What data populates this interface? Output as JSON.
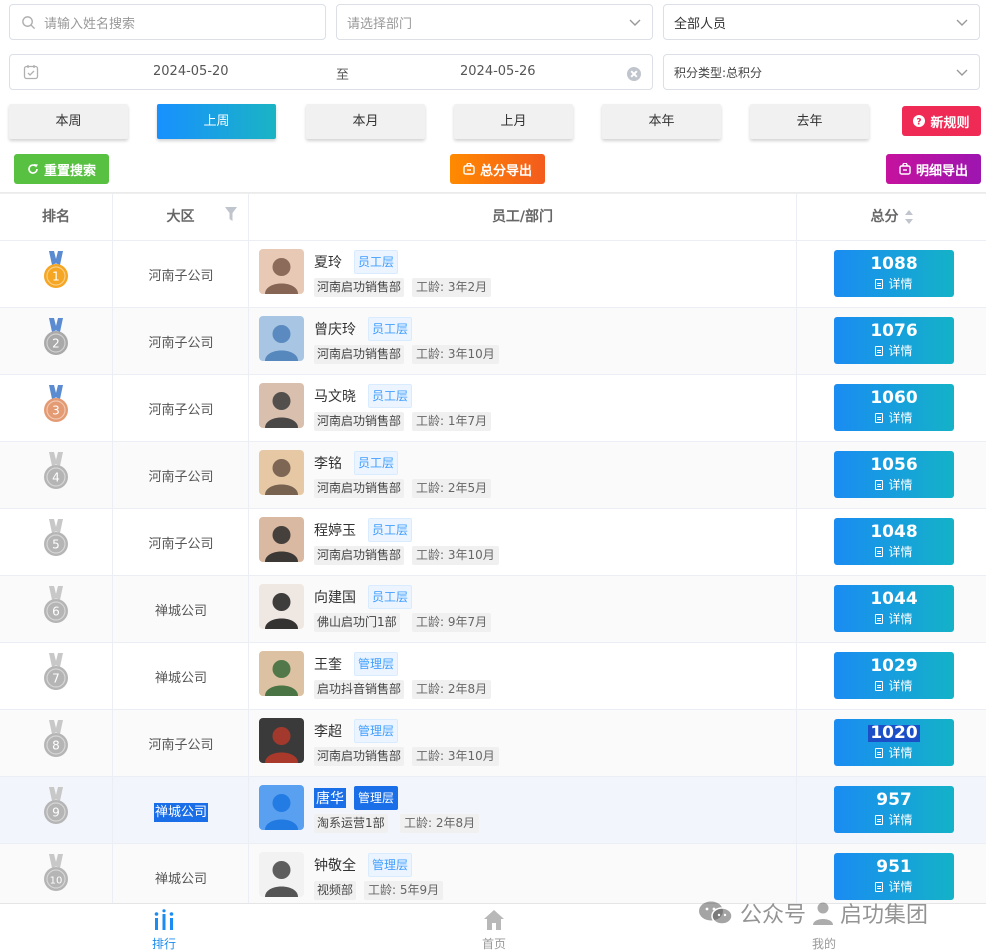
{
  "filters": {
    "search_placeholder": "请输入姓名搜索",
    "dept_placeholder": "请选择部门",
    "people_value": "全部人员",
    "date_start": "2024-05-20",
    "date_to": "至",
    "date_end": "2024-05-26",
    "type_value": "积分类型:总积分"
  },
  "periods": [
    "本周",
    "上周",
    "本月",
    "上月",
    "本年",
    "去年"
  ],
  "active_period": "上周",
  "actions": {
    "new_rule": "新规则",
    "reset": "重置搜索",
    "total_export": "总分导出",
    "detail_export": "明细导出"
  },
  "columns": {
    "rank": "排名",
    "region": "大区",
    "employee": "员工/部门",
    "score": "总分"
  },
  "rows": [
    {
      "rank": "1",
      "region": "河南子公司",
      "name": "夏玲",
      "level": "员工层",
      "dept": "河南启功销售部",
      "tenure": "工龄: 3年2月",
      "score": "1088",
      "detail": "详情"
    },
    {
      "rank": "2",
      "region": "河南子公司",
      "name": "曾庆玲",
      "level": "员工层",
      "dept": "河南启功销售部",
      "tenure": "工龄: 3年10月",
      "score": "1076",
      "detail": "详情"
    },
    {
      "rank": "3",
      "region": "河南子公司",
      "name": "马文晓",
      "level": "员工层",
      "dept": "河南启功销售部",
      "tenure": "工龄: 1年7月",
      "score": "1060",
      "detail": "详情"
    },
    {
      "rank": "4",
      "region": "河南子公司",
      "name": "李铭",
      "level": "员工层",
      "dept": "河南启功销售部",
      "tenure": "工龄: 2年5月",
      "score": "1056",
      "detail": "详情"
    },
    {
      "rank": "5",
      "region": "河南子公司",
      "name": "程婷玉",
      "level": "员工层",
      "dept": "河南启功销售部",
      "tenure": "工龄: 3年10月",
      "score": "1048",
      "detail": "详情"
    },
    {
      "rank": "6",
      "region": "禅城公司",
      "name": "向建国",
      "level": "员工层",
      "dept": "佛山启功门1部",
      "tenure": "工龄: 9年7月",
      "score": "1044",
      "detail": "详情"
    },
    {
      "rank": "7",
      "region": "禅城公司",
      "name": "王奎",
      "level": "管理层",
      "dept": "启功抖音销售部",
      "tenure": "工龄: 2年8月",
      "score": "1029",
      "detail": "详情"
    },
    {
      "rank": "8",
      "region": "河南子公司",
      "name": "李超",
      "level": "管理层",
      "dept": "河南启功销售部",
      "tenure": "工龄: 3年10月",
      "score": "1020",
      "detail": "详情"
    },
    {
      "rank": "9",
      "region": "禅城公司",
      "name": "唐华",
      "level": "管理层",
      "dept": "淘系运营1部",
      "tenure": "工龄: 2年8月",
      "score": "957",
      "detail": "详情"
    },
    {
      "rank": "10",
      "region": "禅城公司",
      "name": "钟敬全",
      "level": "管理层",
      "dept": "视频部",
      "tenure": "工龄: 5年9月",
      "score": "951",
      "detail": "详情"
    }
  ],
  "medal_colors": {
    "gold": "#f5a623",
    "silver": "#a9a9a9",
    "bronze": "#e49a72",
    "grey": "#b5b5b5",
    "ribbon": "#5b8bd0"
  },
  "nav": {
    "rank": "排行",
    "home": "首页",
    "mine": "我的"
  },
  "watermark": {
    "text1": "公众号",
    "text2": "启功集团"
  }
}
